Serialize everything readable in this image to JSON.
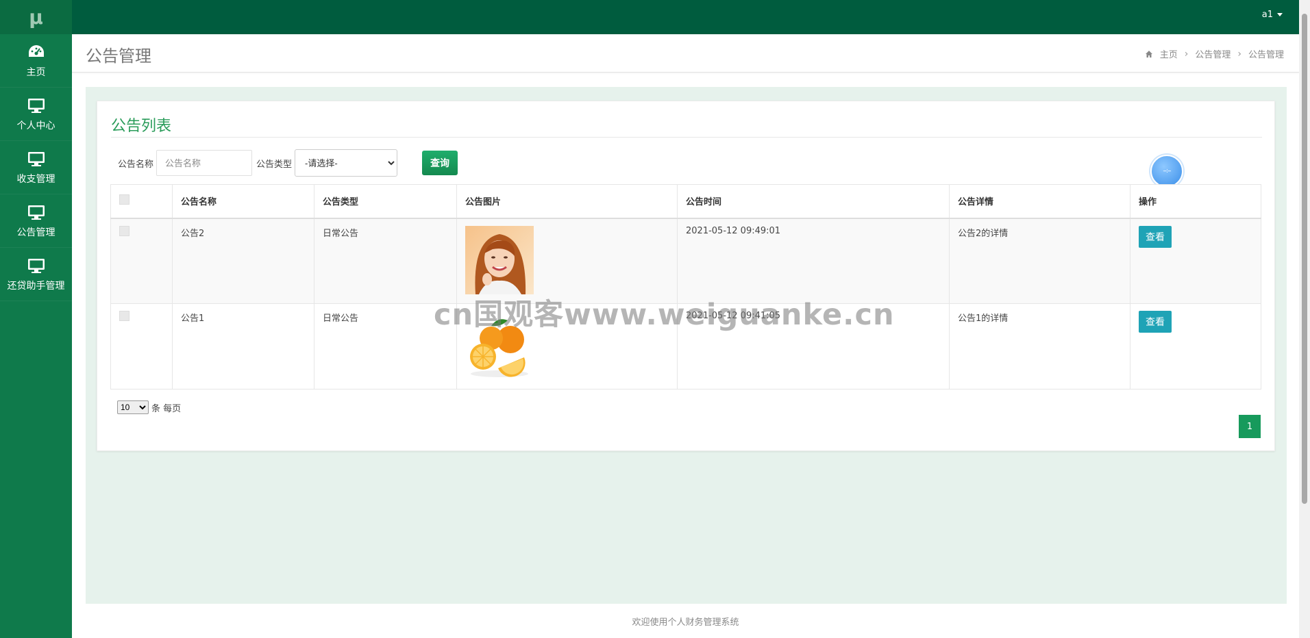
{
  "app": {
    "logo": "μ",
    "footer": "欢迎使用个人财务管理系统"
  },
  "user": {
    "name": "a1"
  },
  "sidebar": {
    "items": [
      {
        "label": "主页",
        "icon": "dashboard-icon"
      },
      {
        "label": "个人中心",
        "icon": "monitor-icon"
      },
      {
        "label": "收支管理",
        "icon": "monitor-icon"
      },
      {
        "label": "公告管理",
        "icon": "monitor-icon"
      },
      {
        "label": "还贷助手管理",
        "icon": "monitor-icon"
      }
    ]
  },
  "header": {
    "title": "公告管理",
    "breadcrumb": [
      "主页",
      "公告管理",
      "公告管理"
    ]
  },
  "panel": {
    "title": "公告列表",
    "search": {
      "name_label": "公告名称",
      "name_placeholder": "公告名称",
      "type_label": "公告类型",
      "type_selected": "-请选择-",
      "query_label": "查询"
    },
    "table": {
      "columns": [
        "公告名称",
        "公告类型",
        "公告图片",
        "公告时间",
        "公告详情",
        "操作"
      ],
      "rows": [
        {
          "name": "公告2",
          "type": "日常公告",
          "image": "woman-portrait",
          "time": "2021-05-12 09:49:01",
          "detail": "公告2的详情",
          "action": "查看"
        },
        {
          "name": "公告1",
          "type": "日常公告",
          "image": "oranges",
          "time": "2021-05-12 09:41:05",
          "detail": "公告1的详情",
          "action": "查看"
        }
      ]
    },
    "pagination": {
      "page_size": "10",
      "page_size_suffix": "条 每页",
      "current_page": "1"
    }
  },
  "float_ball": {
    "text": "--:--"
  },
  "watermark": "cn国观客www.weiguanke.cn",
  "colors": {
    "sidebar": "#0f7a4b",
    "topbar": "#005c3e",
    "accent": "#2a9c5a",
    "view_button": "#1fa3b6"
  }
}
